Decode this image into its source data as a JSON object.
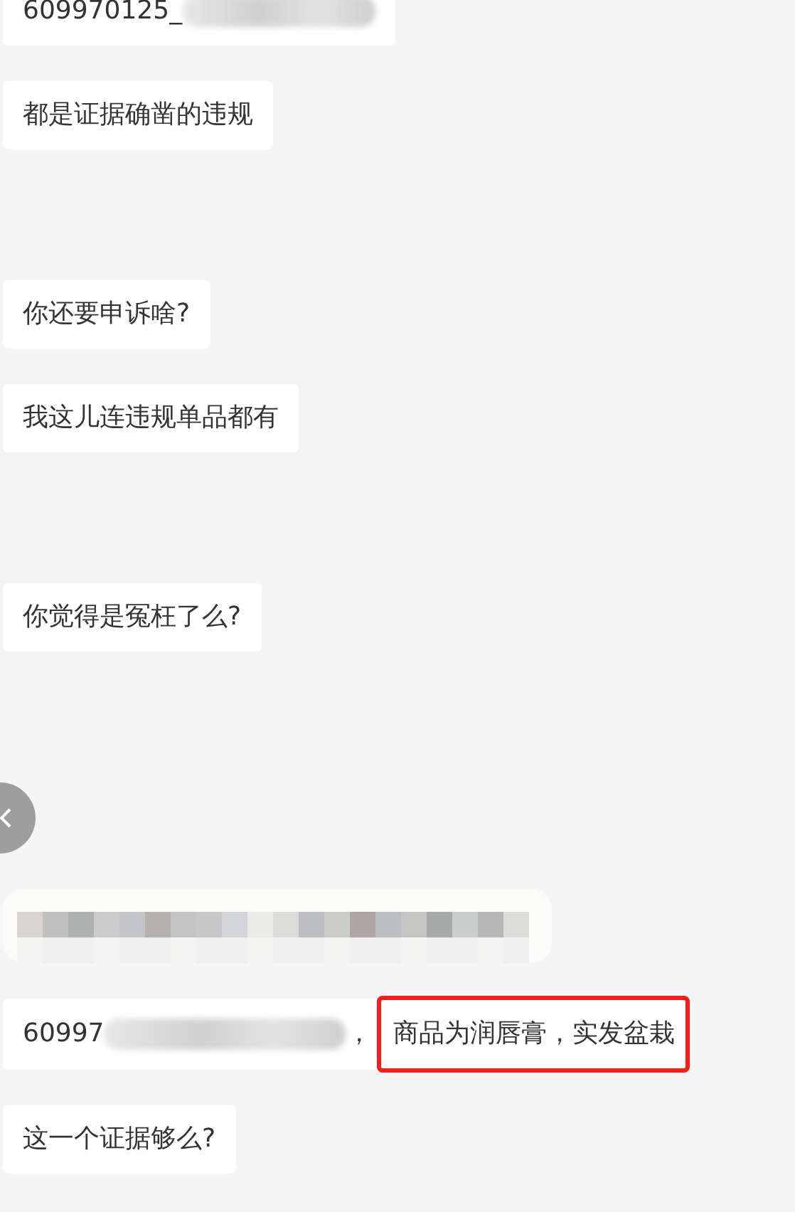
{
  "groups": [
    {
      "messages": [
        {
          "kind": "redacted_id",
          "text": "609970125_"
        },
        {
          "kind": "text",
          "text": "都是证据确凿的违规"
        }
      ]
    },
    {
      "messages": [
        {
          "kind": "text",
          "text": "你还要申诉啥?"
        },
        {
          "kind": "text",
          "text": "我这儿连违规单品都有"
        }
      ]
    },
    {
      "messages": [
        {
          "kind": "text",
          "text": "你觉得是冤枉了么?"
        }
      ]
    },
    {
      "messages": [
        {
          "kind": "back_button"
        },
        {
          "kind": "pixelated"
        },
        {
          "kind": "highlighted",
          "text": "60997",
          "suffix": "，",
          "highlight": "商品为润唇膏，实发盆栽"
        },
        {
          "kind": "text",
          "text": "这一个证据够么?"
        }
      ]
    }
  ]
}
